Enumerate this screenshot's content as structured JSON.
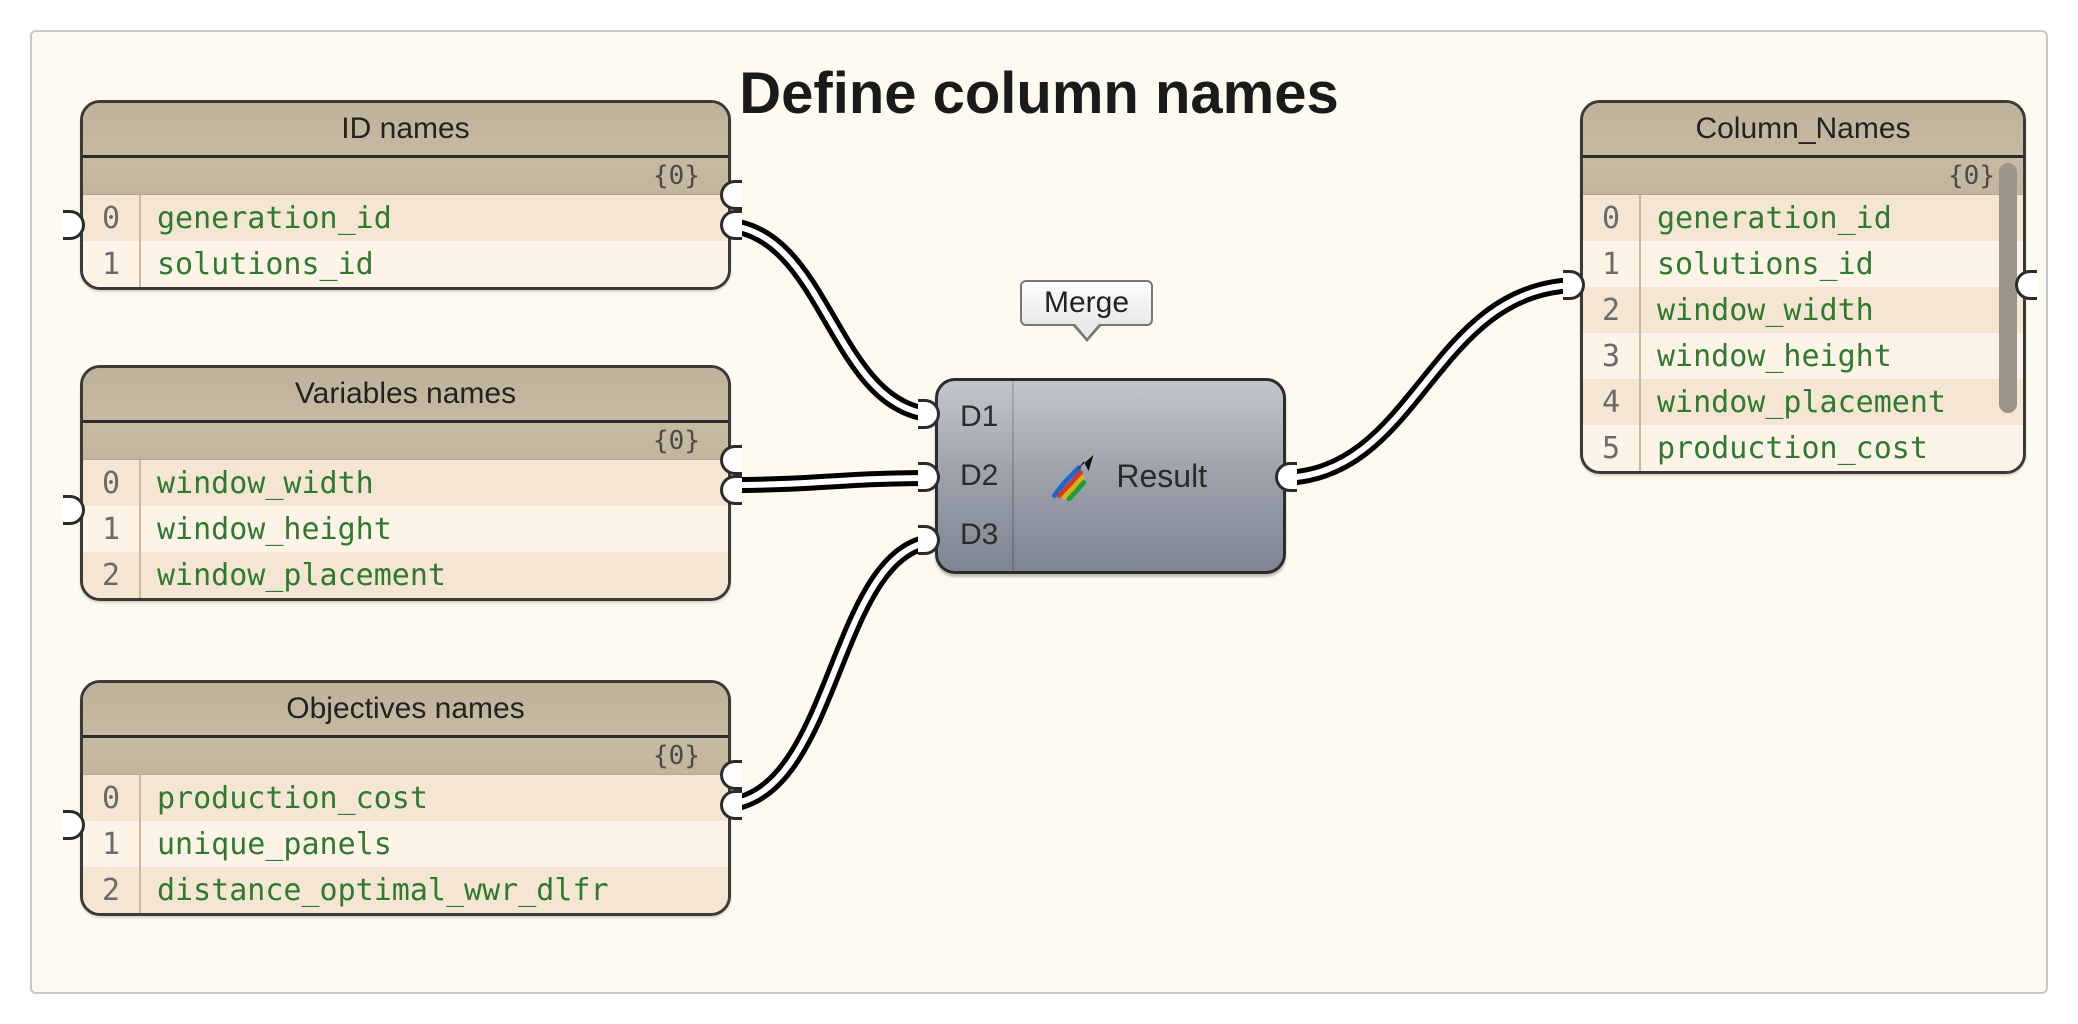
{
  "canvas": {
    "title": "Define column names"
  },
  "panels": {
    "id_names": {
      "title": "ID names",
      "path_label": "{0}",
      "items": [
        "generation_id",
        "solutions_id"
      ]
    },
    "var_names": {
      "title": "Variables names",
      "path_label": "{0}",
      "items": [
        "window_width",
        "window_height",
        "window_placement"
      ]
    },
    "obj_names": {
      "title": "Objectives names",
      "path_label": "{0}",
      "items": [
        "production_cost",
        "unique_panels",
        "distance_optimal_wwr_dlfr"
      ]
    },
    "column_names": {
      "title": "Column_Names",
      "path_label": "{0}",
      "items": [
        "generation_id",
        "solutions_id",
        "window_width",
        "window_height",
        "window_placement",
        "production_cost"
      ]
    }
  },
  "merge": {
    "label": "Merge",
    "inputs": [
      "D1",
      "D2",
      "D3"
    ],
    "output": "Result"
  }
}
